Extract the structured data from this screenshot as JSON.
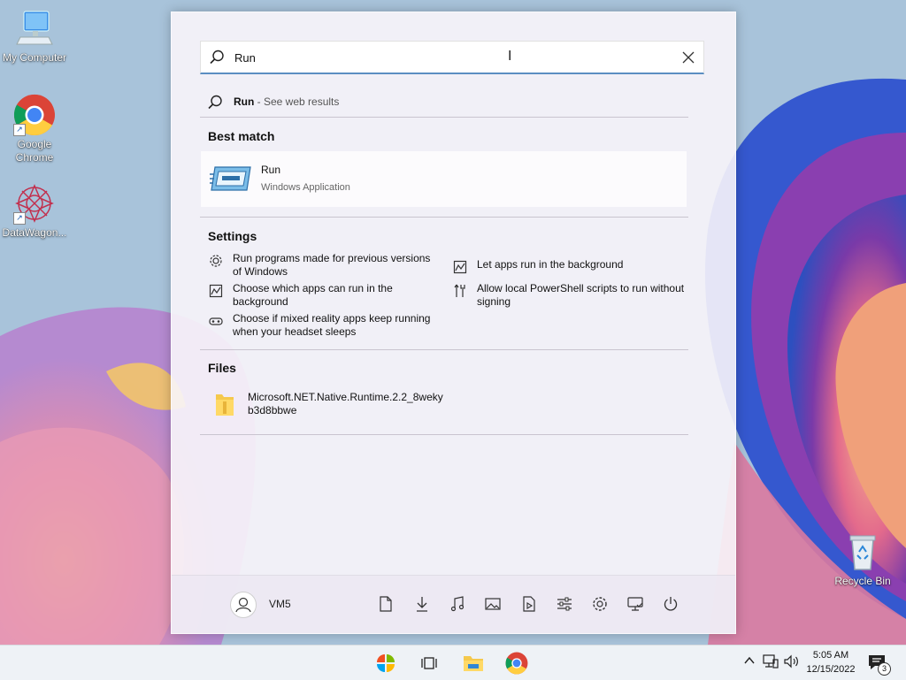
{
  "desktop": {
    "icons": [
      {
        "label": "My Computer",
        "icon": "computer-icon"
      },
      {
        "label": "Google Chrome",
        "icon": "chrome-icon"
      },
      {
        "label": "DataWagon...",
        "icon": "datawagon-icon"
      },
      {
        "label": "Recycle Bin",
        "icon": "recycle-bin-icon"
      }
    ]
  },
  "search": {
    "value": "Run",
    "placeholder": ""
  },
  "web_result": {
    "query": "Run",
    "suffix": " - See web results"
  },
  "best_match": {
    "title": "Best match",
    "name": "Run",
    "type": "Windows Application"
  },
  "settings": {
    "title": "Settings",
    "items": [
      {
        "label": "Run programs made for previous versions of Windows",
        "icon": "gear-icon"
      },
      {
        "label": "Choose which apps can run in the background",
        "icon": "chart-icon"
      },
      {
        "label": "Choose if mixed reality apps keep running when your headset sleeps",
        "icon": "headset-icon"
      },
      {
        "label": "Let apps run in the background",
        "icon": "chart-icon"
      },
      {
        "label": "Allow local PowerShell scripts to run without signing",
        "icon": "tools-icon"
      }
    ]
  },
  "files": {
    "title": "Files",
    "items": [
      {
        "label": "Microsoft.NET.Native.Runtime.2.2_8wekyb3d8bbwe",
        "line1": "Microsoft.NET.Native.Runtime.2.2_8weky",
        "line2": "b3d8bbwe",
        "icon": "folder-icon"
      }
    ]
  },
  "footer": {
    "user": "VM5",
    "buttons": [
      "documents-icon",
      "downloads-icon",
      "music-icon",
      "pictures-icon",
      "videos-icon",
      "settings-sliders-icon",
      "gear-icon",
      "network-icon",
      "power-icon"
    ]
  },
  "taskbar": {
    "apps": [
      "start-icon",
      "task-view-icon",
      "file-explorer-icon",
      "chrome-icon"
    ],
    "time": "5:05 AM",
    "date": "12/15/2022",
    "notifications": "3"
  }
}
